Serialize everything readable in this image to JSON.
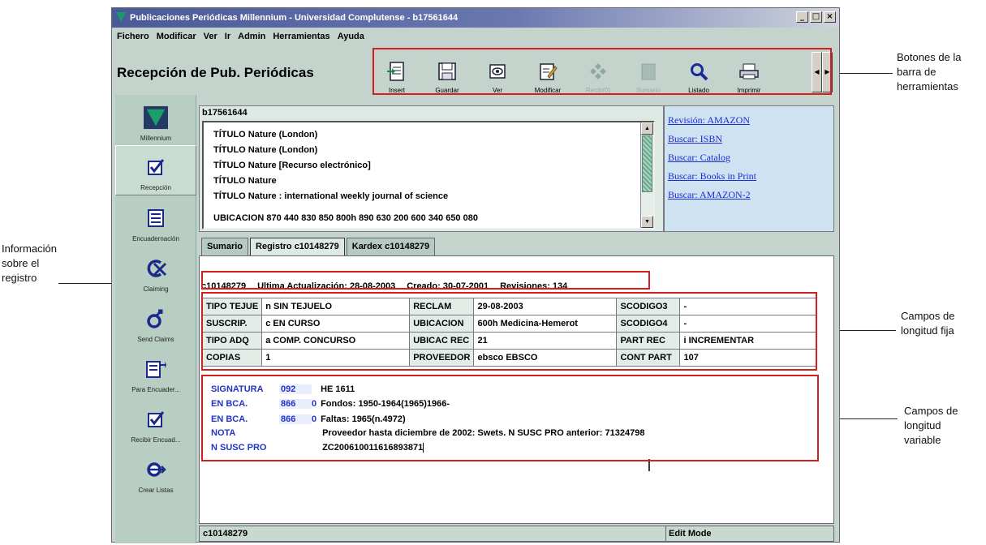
{
  "window": {
    "title": "Publicaciones Periódicas Millennium - Universidad Complutense - b17561644",
    "controls": [
      "_",
      "□",
      "×"
    ]
  },
  "menu": [
    "Fichero",
    "Modificar",
    "Ver",
    "Ir",
    "Admin",
    "Herramientas",
    "Ayuda"
  ],
  "app_title": "Recepción de Pub. Periódicas",
  "toolbar": {
    "buttons": [
      {
        "label": "Insert",
        "icon": "insert-icon",
        "enabled": true
      },
      {
        "label": "Guardar",
        "icon": "save-icon",
        "enabled": true
      },
      {
        "label": "Ver",
        "icon": "view-icon",
        "enabled": true
      },
      {
        "label": "Modificar",
        "icon": "edit-icon",
        "enabled": true
      },
      {
        "label": "Recib(0)",
        "icon": "receive-icon",
        "enabled": false
      },
      {
        "label": "Sumario",
        "icon": "summary-icon",
        "enabled": false
      },
      {
        "label": "Listado",
        "icon": "search-icon",
        "enabled": true
      },
      {
        "label": "Imprimir",
        "icon": "print-icon",
        "enabled": true
      }
    ]
  },
  "sidebar": [
    {
      "label": "Millennium",
      "icon": "millennium-logo-icon"
    },
    {
      "label": "Recepción",
      "icon": "checkbox-icon"
    },
    {
      "label": "Encuadernación",
      "icon": "binding-list-icon"
    },
    {
      "label": "Claiming",
      "icon": "claiming-icon"
    },
    {
      "label": "Send Claims",
      "icon": "send-claims-icon"
    },
    {
      "label": "Para Encuader...",
      "icon": "to-bind-icon"
    },
    {
      "label": "Recibir Encuad...",
      "icon": "receive-binding-icon"
    },
    {
      "label": "Crear Listas",
      "icon": "create-lists-icon"
    }
  ],
  "bib": {
    "id": "b17561644",
    "lines": [
      "TÍTULO  Nature (London)",
      "TÍTULO  Nature (London)",
      "TÍTULO  Nature [Recurso electrónico]",
      "TÍTULO  Nature",
      "TÍTULO  Nature : international weekly journal of science",
      "UBICACION  870   440   830   850   800h  890   630   200   600   340   650   080"
    ]
  },
  "links": [
    "Revisión: AMAZON",
    "Buscar: ISBN",
    "Buscar: Catalog",
    "Buscar: Books in Print",
    "Buscar: AMAZON-2"
  ],
  "tabs": [
    "Sumario",
    "Registro c10148279",
    "Kardex c10148279"
  ],
  "record_info": {
    "id": "c10148279",
    "updated": "Ultima Actualización: 28-08-2003",
    "created": "Creado: 30-07-2001",
    "revisions": "Revisiones: 134"
  },
  "fixed_fields": [
    [
      {
        "k": "TIPO TEJUE",
        "v": "n  SIN TEJUELO"
      },
      {
        "k": "RECLAM",
        "v": "29-08-2003"
      },
      {
        "k": "SCODIGO3",
        "v": "-"
      }
    ],
    [
      {
        "k": "SUSCRIP.",
        "v": "c  EN CURSO"
      },
      {
        "k": "UBICACION",
        "v": "600h   Medicina-Hemerot"
      },
      {
        "k": "SCODIGO4",
        "v": "-"
      }
    ],
    [
      {
        "k": "TIPO ADQ",
        "v": "a  COMP. CONCURSO"
      },
      {
        "k": "UBICAC REC",
        "v": "21"
      },
      {
        "k": "PART REC",
        "v": "i  INCREMENTAR"
      }
    ],
    [
      {
        "k": "COPIAS",
        "v": "1"
      },
      {
        "k": "PROVEEDOR",
        "v": "ebsco   EBSCO"
      },
      {
        "k": "CONT PART",
        "v": "107"
      }
    ]
  ],
  "variable_fields": [
    {
      "tag": "SIGNATURA",
      "ind": "092",
      "sub": "",
      "value": "HE 1611"
    },
    {
      "tag": "EN BCA.",
      "ind": "866",
      "sub": "0",
      "value": "Fondos: 1950-1964(1965)1966-"
    },
    {
      "tag": "EN BCA.",
      "ind": "866",
      "sub": "0",
      "value": "Faltas: 1965(n.4972)"
    },
    {
      "tag": "NOTA",
      "ind": "",
      "sub": "",
      "value": "Proveedor hasta diciembre de 2002: Swets. N SUSC PRO anterior: 71324798"
    },
    {
      "tag": "N SUSC PRO",
      "ind": "",
      "sub": "",
      "value": "ZC200610011616893871"
    }
  ],
  "status": {
    "id": "c10148279",
    "mode": "Edit Mode"
  },
  "annotations": {
    "toolbar": [
      "Botones de la",
      "barra de",
      "herramientas"
    ],
    "record_info": [
      "Información",
      "sobre el",
      "registro"
    ],
    "fixed": [
      "Campos de",
      "longitud fija"
    ],
    "variable": [
      "Campos de",
      "longitud",
      "variable"
    ]
  }
}
